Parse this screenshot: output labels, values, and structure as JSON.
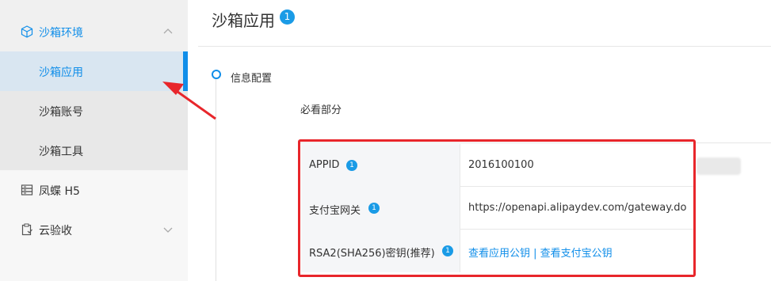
{
  "sidebar": {
    "group": {
      "label": "沙箱环境",
      "icon": "cube-icon"
    },
    "sub_items": [
      {
        "label": "沙箱应用",
        "active": true
      },
      {
        "label": "沙箱账号",
        "active": false
      },
      {
        "label": "沙箱工具",
        "active": false
      }
    ],
    "items": [
      {
        "label": "凤蝶 H5",
        "icon": "server-icon"
      },
      {
        "label": "云验收",
        "icon": "clipboard-icon"
      }
    ]
  },
  "main": {
    "title": "沙箱应用",
    "title_badge": "1",
    "section": "信息配置",
    "subsection": "必看部分",
    "rows": [
      {
        "key": "APPID",
        "badge": "1",
        "value": "2016100100"
      },
      {
        "key": "支付宝网关",
        "badge": "1",
        "value": "https://openapi.alipaydev.com/gateway.do"
      },
      {
        "key": "RSA2(SHA256)密钥(推荐)",
        "badge": "1",
        "link1": "查看应用公钥",
        "sep": " | ",
        "link2": "查看支付宝公钥"
      }
    ]
  },
  "colors": {
    "accent": "#108ee9",
    "highlight": "#e8262b",
    "active_bg": "#d9e6f1"
  }
}
